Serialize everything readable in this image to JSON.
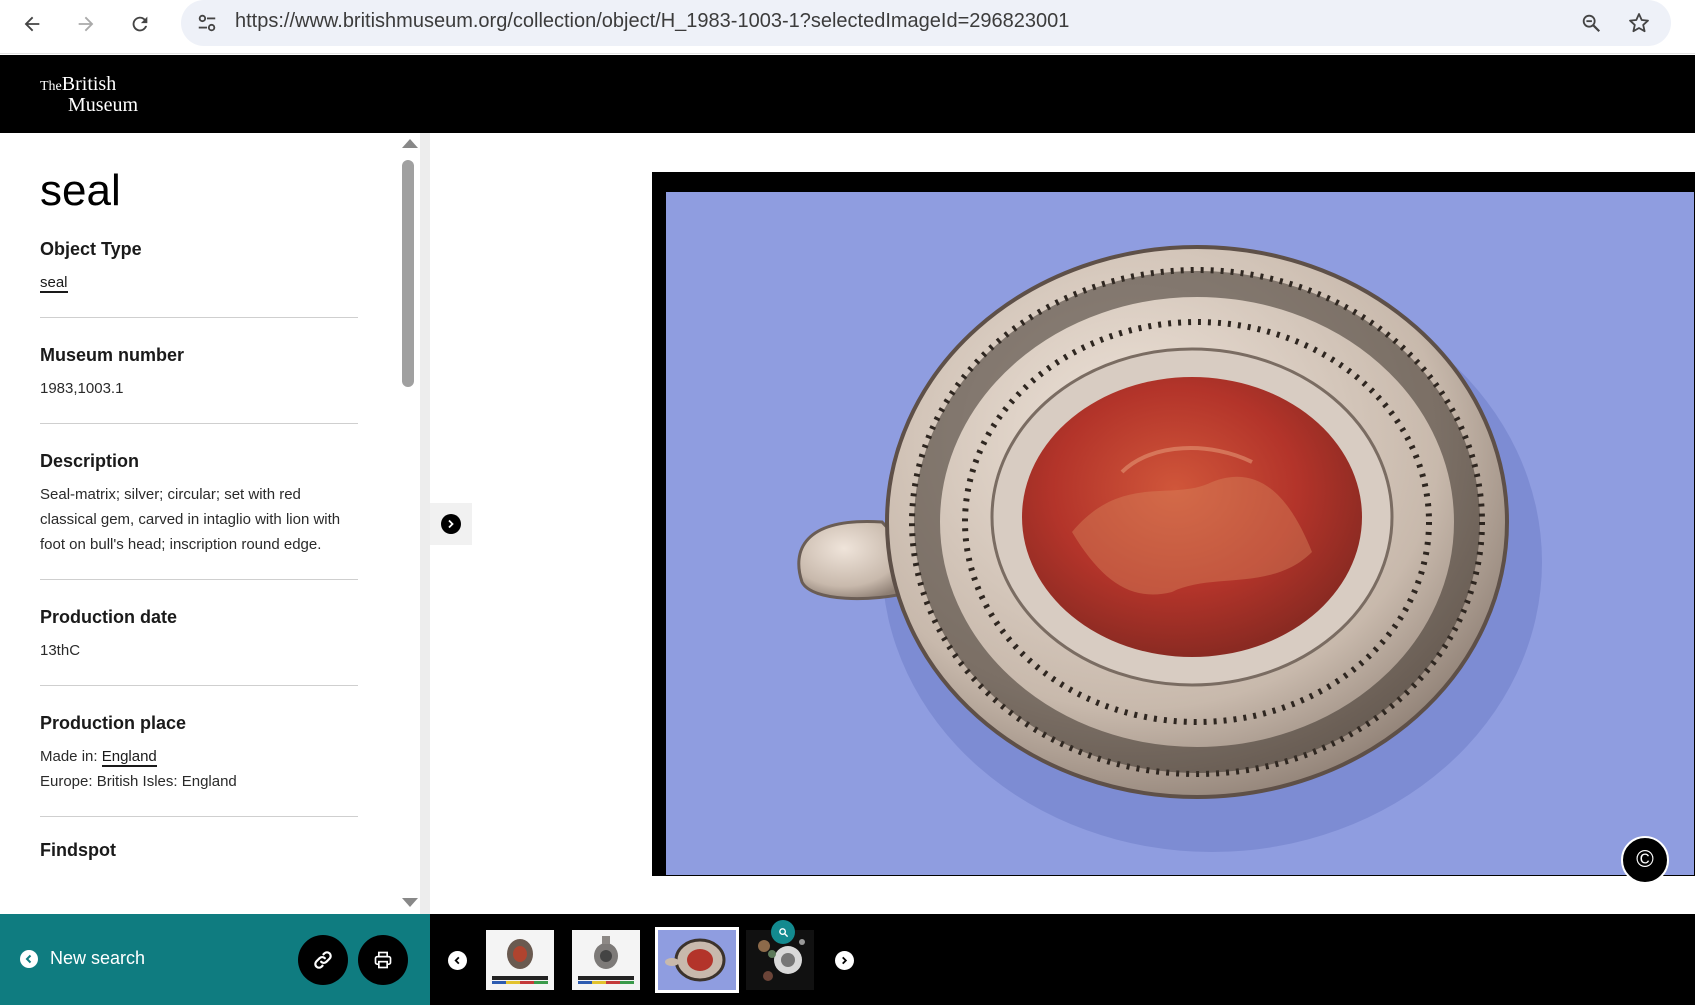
{
  "browser": {
    "url": "https://www.britishmuseum.org/collection/object/H_1983-1003-1?selectedImageId=296823001",
    "icons": [
      "back-icon",
      "forward-icon",
      "reload-icon",
      "site-info-icon",
      "zoom-icon",
      "bookmark-star-icon"
    ]
  },
  "site": {
    "logo_the": "The",
    "logo_line1": "British",
    "logo_line2": "Museum"
  },
  "object": {
    "title": "seal",
    "fields": {
      "object_type": {
        "label": "Object Type",
        "value": "seal"
      },
      "museum_number": {
        "label": "Museum number",
        "value": "1983,1003.1"
      },
      "description": {
        "label": "Description",
        "value": "Seal-matrix; silver; circular; set with red classical gem, carved in intaglio with lion with foot on bull's head; inscription round edge."
      },
      "production_date": {
        "label": "Production date",
        "value": "13thC"
      },
      "production_place": {
        "label": "Production place",
        "made_in_prefix": "Made in:",
        "made_in_link": "England",
        "region": "Europe: British Isles: England"
      },
      "findspot": {
        "label": "Findspot"
      }
    }
  },
  "viewer": {
    "copyright_symbol": "©",
    "thumbnails": 4,
    "selected_thumbnail": 3
  },
  "actions": {
    "new_search": "New search",
    "icons": [
      "link-icon",
      "print-icon"
    ]
  },
  "colors": {
    "header_bg": "#000000",
    "action_bar_bg": "#0f7c80",
    "thumb_badge": "#138a8f",
    "seal_background_blue": "#8f9de0",
    "seal_gem_red": "#b8382c"
  }
}
